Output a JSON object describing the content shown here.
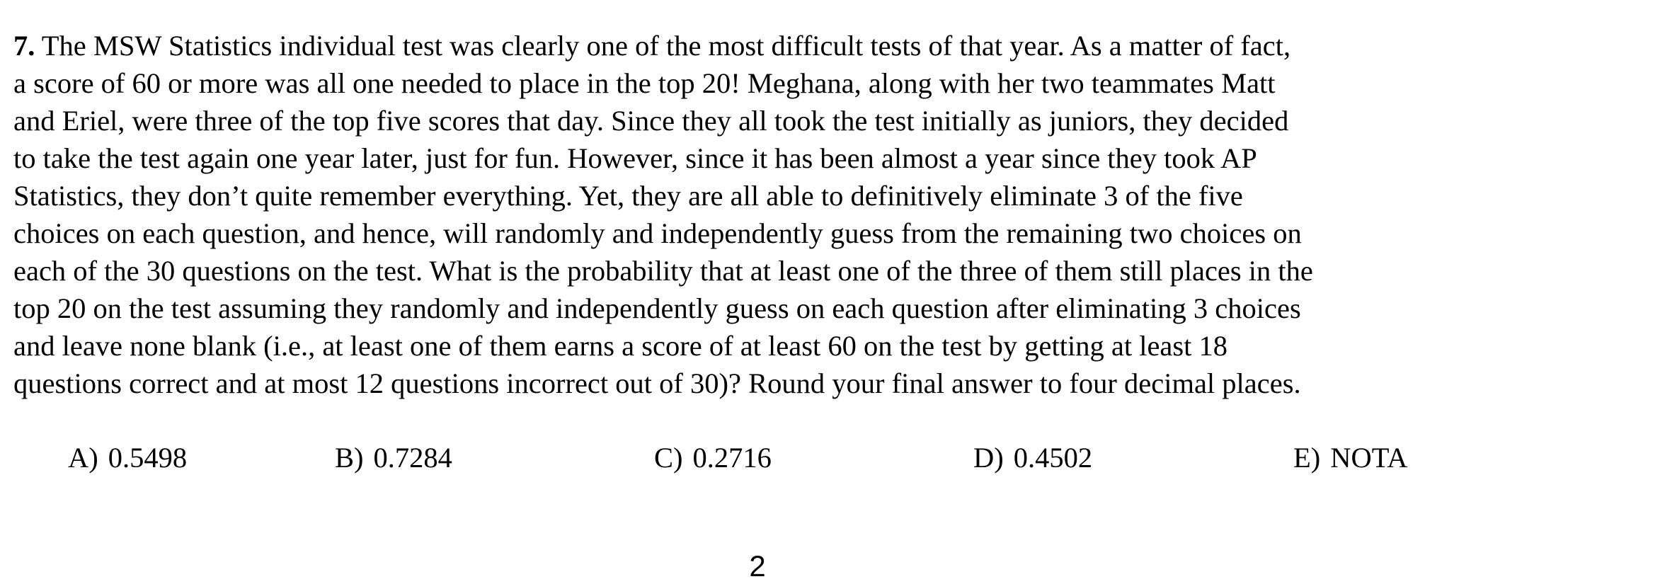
{
  "question": {
    "number": "7.",
    "lines": [
      " The MSW Statistics individual test was clearly one of the most difficult tests of that year.  As a matter of fact,",
      "a score of 60 or more was all one needed to place in the top 20!  Meghana, along with her two teammates Matt",
      "and Eriel, were three of the top five scores that day.  Since they all took the test initially as juniors, they decided",
      "to take the test again one year later, just for fun.  However, since it has been almost a year since they took AP",
      "Statistics, they don’t quite remember everything.  Yet, they are all able to definitively eliminate 3 of the five",
      "choices on each question, and hence, will randomly and independently guess from the remaining two choices on",
      "each of the 30 questions on the test.  What is the probability that at least one of the three of them still places in the",
      "top 20 on the test assuming they randomly and independently guess on each question after eliminating 3 choices",
      "and leave none blank (i.e., at least one of them earns a score of at least 60 on the test by getting at least 18",
      "questions correct and at most 12 questions incorrect out of 30)?  Round your final answer to four decimal places."
    ]
  },
  "choices": [
    {
      "letter": "A)",
      "value": "0.5498"
    },
    {
      "letter": "B)",
      "value": "0.7284"
    },
    {
      "letter": "C)",
      "value": "0.2716"
    },
    {
      "letter": "D)",
      "value": "0.4502"
    },
    {
      "letter": "E)",
      "value": "NOTA"
    }
  ],
  "page_number": "2"
}
